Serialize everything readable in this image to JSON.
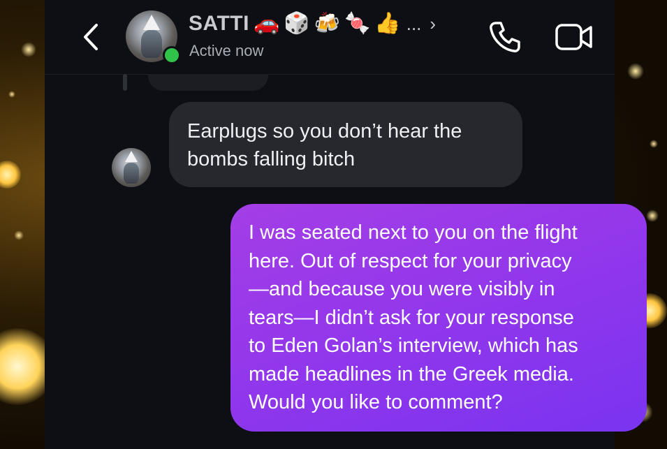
{
  "header": {
    "contact_name": "SATTI",
    "name_emojis": [
      "🚗",
      "🎲",
      "🍻",
      "🍬",
      "👍"
    ],
    "name_overflow": "...",
    "status": "Active now",
    "online_color": "#31c24a",
    "icons": {
      "back": "back-arrow-icon",
      "chevron": "chevron-right-icon",
      "call": "phone-icon",
      "video": "video-camera-icon"
    }
  },
  "messages": [
    {
      "direction": "incoming",
      "text": "Earplugs so you don’t hear the bombs falling bitch",
      "lines": [
        "Earplugs so you don’t hear the",
        "bombs falling bitch"
      ]
    },
    {
      "direction": "outgoing",
      "text": "I was seated next to you on the flight here. Out of respect for your privacy—and because you were visibly in tears—I didn’t ask for your response to Eden Golan’s interview, which has made headlines in the Greek media. Would you like to comment?",
      "lines": [
        "I was seated next to you on the flight",
        "here. Out of respect for your privacy",
        "—and because you were visibly in",
        "tears—I didn’t ask for your response",
        "to Eden Golan’s interview, which has",
        "made headlines in the Greek media.",
        "Would you like to comment?"
      ]
    }
  ],
  "colors": {
    "incoming_bubble": "#26282e",
    "outgoing_bubble": "#8f36ec",
    "background": "#0d0f14"
  }
}
